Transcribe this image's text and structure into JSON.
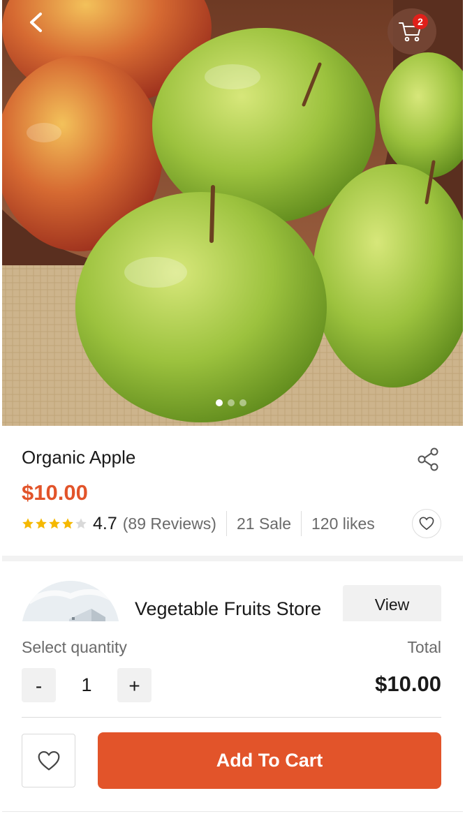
{
  "header": {
    "back_icon": "chevron-left-icon",
    "cart_icon": "shopping-cart-icon",
    "cart_badge": "2"
  },
  "gallery": {
    "subject": "apple-photo",
    "active_slide": 1,
    "slide_count": 3
  },
  "product": {
    "title": "Organic Apple",
    "price": "$10.00",
    "rating": "4.7",
    "stars_filled": 4,
    "stars_total": 5,
    "reviews": "(89 Reviews)",
    "sales": "21 Sale",
    "likes": "120 likes",
    "share_icon": "share-icon",
    "like_icon": "heart-icon"
  },
  "store": {
    "name": "Vegetable Fruits Store",
    "view_label": "View"
  },
  "quantity": {
    "label": "Select quantity",
    "total_label": "Total",
    "minus": "-",
    "value": "1",
    "plus": "+",
    "total": "$10.00"
  },
  "actions": {
    "wishlist_icon": "heart-icon",
    "add_to_cart": "Add To Cart"
  },
  "colors": {
    "accent": "#e2542a",
    "star": "#f5b800",
    "badge": "#e0201a"
  }
}
